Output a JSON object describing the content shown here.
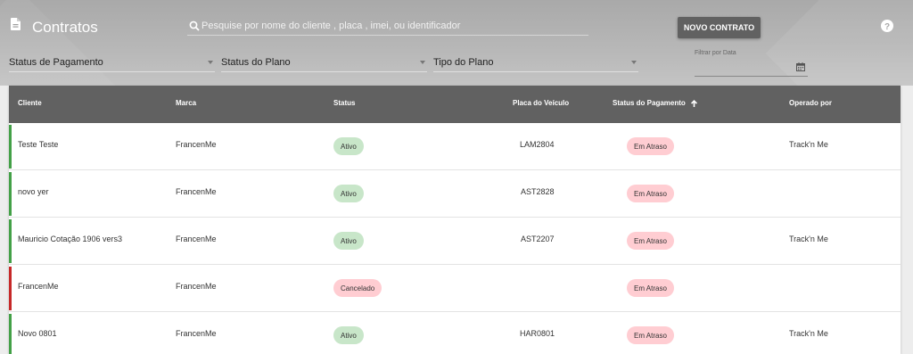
{
  "colors": {
    "header_bg": "#616161",
    "active_bg": "#c8e6c9",
    "late_bg": "#ffcdd2",
    "active_bar": "#43a047",
    "cancel_bar": "#c62828"
  },
  "header": {
    "title": "Contratos",
    "title_icon": "document-icon",
    "search_placeholder": "Pesquise por nome do cliente , placa , imei, ou identificador",
    "new_button": "NOVO CONTRATO",
    "help_icon": "help-circle-icon"
  },
  "filters": {
    "payment_status": "Status de Pagamento",
    "plan_status": "Status do Plano",
    "plan_type": "Tipo do Plano",
    "date_label": "Filtrar por Data",
    "date_value": ""
  },
  "table": {
    "columns": {
      "cliente": "Cliente",
      "marca": "Marca",
      "status": "Status",
      "placa": "Placa do Veículo",
      "pagamento": "Status do Pagamento",
      "operado": "Operado por"
    },
    "sort_icon": "arrow-up-icon",
    "rows": [
      {
        "cliente": "Teste Teste",
        "marca": "FrancenMe",
        "status": "Ativo",
        "placa": "LAM2804",
        "pagamento": "Em Atraso",
        "operado": "Track'n Me",
        "kind": "active"
      },
      {
        "cliente": "novo yer",
        "marca": "FrancenMe",
        "status": "Ativo",
        "placa": "AST2828",
        "pagamento": "Em Atraso",
        "operado": "",
        "kind": "active"
      },
      {
        "cliente": "Mauricio Cotação 1906 vers3",
        "marca": "FrancenMe",
        "status": "Ativo",
        "placa": "AST2207",
        "pagamento": "Em Atraso",
        "operado": "Track'n Me",
        "kind": "active"
      },
      {
        "cliente": "FrancenMe",
        "marca": "FrancenMe",
        "status": "Cancelado",
        "placa": "",
        "pagamento": "Em Atraso",
        "operado": "",
        "kind": "cancelled"
      },
      {
        "cliente": "Novo 0801",
        "marca": "FrancenMe",
        "status": "Ativo",
        "placa": "HAR0801",
        "pagamento": "Em Atraso",
        "operado": "Track'n Me",
        "kind": "active"
      }
    ]
  }
}
